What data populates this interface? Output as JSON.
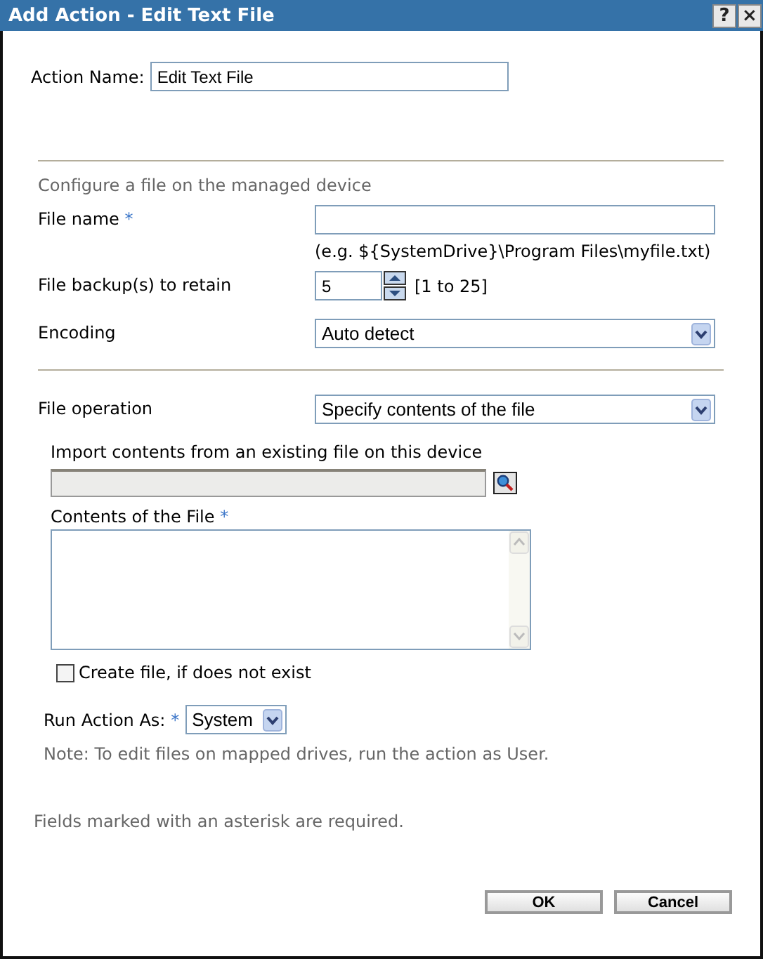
{
  "window": {
    "title": "Add Action - Edit Text File",
    "help_button": "?",
    "close_button": "×"
  },
  "action_name": {
    "label": "Action Name:",
    "value": "Edit Text File"
  },
  "section_title": "Configure a file on the managed device",
  "file_name": {
    "label": "File name",
    "required_mark": "*",
    "hint": "(e.g. ${SystemDrive}\\Program Files\\myfile.txt)"
  },
  "backups": {
    "label": "File backup(s) to retain",
    "value": "5",
    "range": "[1 to 25]"
  },
  "encoding": {
    "label": "Encoding",
    "value": "Auto detect"
  },
  "file_operation": {
    "label": "File operation",
    "value": "Specify contents of the file"
  },
  "import": {
    "label": "Import contents from an existing file on this device",
    "disabled": true
  },
  "contents": {
    "label": "Contents of the File",
    "required_mark": "*"
  },
  "create_file": {
    "label": "Create file, if does not exist",
    "checked": false
  },
  "run_as": {
    "label": "Run Action As:",
    "required_mark": "*",
    "value": "System",
    "note": "Note: To edit files on mapped drives, run the action as User."
  },
  "footer_note": "Fields marked with an asterisk are required.",
  "buttons": [
    "OK",
    "Cancel"
  ]
}
